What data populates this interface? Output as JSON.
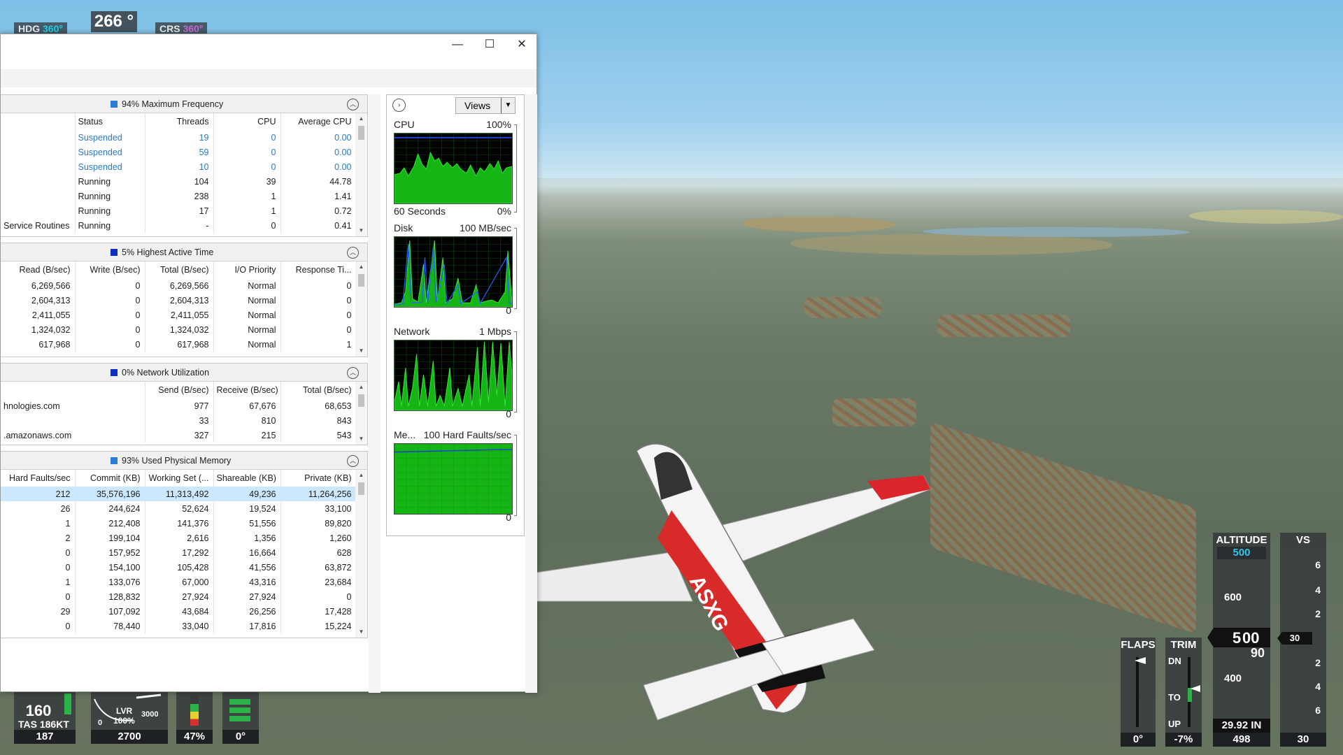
{
  "hud": {
    "hdg_label": "HDG",
    "hdg_value": "360°",
    "heading": "266 °",
    "crs_label": "CRS",
    "crs_value": "360°",
    "speed": "160",
    "tas": "TAS 186KT",
    "speed_bottom": "187",
    "lvr": "LVR",
    "lvr_pct": "100%",
    "rpm_zero": "0",
    "rpm_max": "3000",
    "rpm": "2700",
    "fuel_pct": "47%",
    "gear_angle": "0°",
    "flaps_label": "FLAPS",
    "flaps_value": "0°",
    "trim_label": "TRIM",
    "trim_dn": "DN",
    "trim_to": "TO",
    "trim_up": "UP",
    "trim_value": "-7%",
    "altitude_label": "ALTITUDE",
    "alt_selected": "500",
    "alt_600": "600",
    "alt_current_a": "5",
    "alt_current_b": "00",
    "alt_current_c": "90",
    "alt_400": "400",
    "baro": "29.92 IN",
    "alt_bottom": "498",
    "vs_label": "VS",
    "vs_ticks": [
      "6",
      "4",
      "2",
      "2",
      "4",
      "6"
    ],
    "vs_value": "30",
    "vs_bottom": "30",
    "plane_reg": "ASXG"
  },
  "window": {
    "minimize": "—",
    "maximize": "☐",
    "close": "✕"
  },
  "cpu_panel": {
    "title": "94% Maximum Frequency",
    "color": "#2a7fd4",
    "headers": [
      "Status",
      "Threads",
      "CPU",
      "Average CPU"
    ],
    "rows": [
      {
        "name": "",
        "status": "Suspended",
        "threads": "19",
        "cpu": "0",
        "avg": "0.00",
        "susp": true
      },
      {
        "name": "",
        "status": "Suspended",
        "threads": "59",
        "cpu": "0",
        "avg": "0.00",
        "susp": true
      },
      {
        "name": "",
        "status": "Suspended",
        "threads": "10",
        "cpu": "0",
        "avg": "0.00",
        "susp": true
      },
      {
        "name": "",
        "status": "Running",
        "threads": "104",
        "cpu": "39",
        "avg": "44.78",
        "susp": false
      },
      {
        "name": "",
        "status": "Running",
        "threads": "238",
        "cpu": "1",
        "avg": "1.41",
        "susp": false
      },
      {
        "name": "",
        "status": "Running",
        "threads": "17",
        "cpu": "1",
        "avg": "0.72",
        "susp": false
      },
      {
        "name": "Service Routines",
        "status": "Running",
        "threads": "-",
        "cpu": "0",
        "avg": "0.41",
        "susp": false
      }
    ]
  },
  "disk_panel": {
    "title": "5% Highest Active Time",
    "color": "#0f2fbf",
    "headers": [
      "Read (B/sec)",
      "Write (B/sec)",
      "Total (B/sec)",
      "I/O Priority",
      "Response Ti..."
    ],
    "rows": [
      [
        "6,269,566",
        "0",
        "6,269,566",
        "Normal",
        "0"
      ],
      [
        "2,604,313",
        "0",
        "2,604,313",
        "Normal",
        "0"
      ],
      [
        "2,411,055",
        "0",
        "2,411,055",
        "Normal",
        "0"
      ],
      [
        "1,324,032",
        "0",
        "1,324,032",
        "Normal",
        "0"
      ],
      [
        "617,968",
        "0",
        "617,968",
        "Normal",
        "1"
      ]
    ]
  },
  "net_panel": {
    "title": "0% Network Utilization",
    "color": "#0f2fbf",
    "headers": [
      "Send (B/sec)",
      "Receive (B/sec)",
      "Total (B/sec)"
    ],
    "rows": [
      {
        "name": "hnologies.com",
        "send": "977",
        "recv": "67,676",
        "total": "68,653"
      },
      {
        "name": "",
        "send": "33",
        "recv": "810",
        "total": "843"
      },
      {
        "name": ".amazonaws.com",
        "send": "327",
        "recv": "215",
        "total": "543"
      }
    ]
  },
  "mem_panel": {
    "title": "93% Used Physical Memory",
    "color": "#2a7fd4",
    "headers": [
      "Hard Faults/sec",
      "Commit (KB)",
      "Working Set (...",
      "Shareable (KB)",
      "Private (KB)"
    ],
    "rows": [
      [
        "212",
        "35,576,196",
        "11,313,492",
        "49,236",
        "11,264,256"
      ],
      [
        "26",
        "244,624",
        "52,624",
        "19,524",
        "33,100"
      ],
      [
        "1",
        "212,408",
        "141,376",
        "51,556",
        "89,820"
      ],
      [
        "2",
        "199,104",
        "2,616",
        "1,356",
        "1,260"
      ],
      [
        "0",
        "157,952",
        "17,292",
        "16,664",
        "628"
      ],
      [
        "0",
        "154,100",
        "105,428",
        "41,556",
        "63,872"
      ],
      [
        "1",
        "133,076",
        "67,000",
        "43,316",
        "23,684"
      ],
      [
        "0",
        "128,832",
        "27,924",
        "27,924",
        "0"
      ],
      [
        "29",
        "107,092",
        "43,684",
        "26,256",
        "17,428"
      ],
      [
        "0",
        "78,440",
        "33,040",
        "17,816",
        "15,224"
      ]
    ]
  },
  "graphs": {
    "views_label": "Views",
    "cpu": {
      "name": "CPU",
      "max": "100%",
      "bottom_left": "60 Seconds",
      "bottom_right": "0%"
    },
    "disk": {
      "name": "Disk",
      "max": "100 MB/sec",
      "bottom_right": "0"
    },
    "network": {
      "name": "Network",
      "max": "1 Mbps",
      "bottom_right": "0"
    },
    "memory": {
      "name": "Me...",
      "max": "100 Hard Faults/sec",
      "bottom_right": "0"
    }
  }
}
